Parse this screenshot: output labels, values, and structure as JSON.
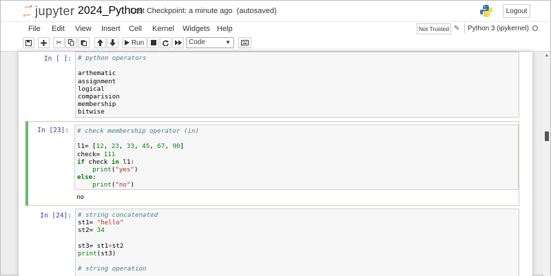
{
  "header": {
    "logo_text": "jupyter",
    "notebook_name": "2024_Python",
    "checkpoint_label": "Last Checkpoint:",
    "checkpoint_time": "a minute ago",
    "autosave_status": "(autosaved)",
    "logout_label": "Logout"
  },
  "menubar": {
    "items": [
      "File",
      "Edit",
      "View",
      "Insert",
      "Cell",
      "Kernel",
      "Widgets",
      "Help"
    ],
    "trust_status": "Not Trusted",
    "kernel_name": "Python 3 (ipykernel)"
  },
  "toolbar": {
    "run_label": "Run",
    "cell_type": "Code"
  },
  "cells": [
    {
      "prompt": "In [ ]:",
      "code_lines": [
        "# python operators",
        "",
        "arthematic",
        "assignment",
        "logical",
        "comparision",
        "membership",
        "bitwise"
      ]
    },
    {
      "prompt": "In [23]:",
      "code_lines": [
        "# check membership operator (in)",
        "",
        "l1= [12, 23, 33, 45, 67, 90]",
        "check= 111",
        "if check in l1:",
        "    print(\"yes\")",
        "else:",
        "    print(\"no\")"
      ],
      "output": "no"
    },
    {
      "prompt": "In [24]:",
      "code_lines": [
        "# string concatenated",
        "st1= \"hello\"",
        "st2= 34",
        "",
        "st3= st1+st2",
        "print(st3)",
        "",
        "# string operation"
      ]
    }
  ],
  "colors": {
    "accent_green": "#66bb6a",
    "prompt_blue": "#303f9f",
    "comment": "#408080",
    "keyword": "#008000",
    "string": "#ba2121"
  }
}
